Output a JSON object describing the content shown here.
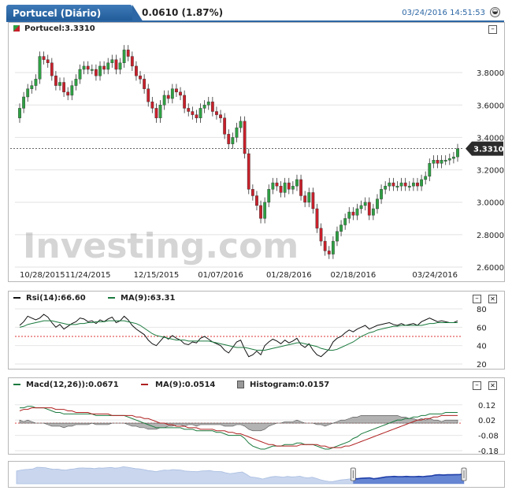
{
  "header": {
    "title": "Portucel (Diário)",
    "change": "0.0610 (1.87%)",
    "timestamp": "03/24/2016 14:51:53"
  },
  "watermark": "Investing.com",
  "main_panel": {
    "legend": "Portucel:3.3310",
    "last_price_label": "3.3310",
    "minimize": "–"
  },
  "rsi_panel": {
    "legend_rsi": "Rsi(14):66.60",
    "legend_ma": "MA(9):63.31",
    "minimize": "–",
    "close": "✕"
  },
  "macd_panel": {
    "legend_macd": "Macd(12,26)):0.0671",
    "legend_signal": "MA(9):0.0514",
    "legend_hist": "Histogram:0.0157",
    "minimize": "–",
    "close": "✕"
  },
  "colors": {
    "up": "#2ea043",
    "down": "#c8202b",
    "accent": "#2d67a5",
    "rsi_ma": "#1a7a3e",
    "macd_signal": "#b02020"
  },
  "chart_data": [
    {
      "type": "candlestick",
      "title": "Portucel:3.3310",
      "x_ticks": [
        "10/28/2015",
        "11/24/2015",
        "12/15/2015",
        "01/07/2016",
        "01/28/2016",
        "02/18/2016",
        "03/24/2016"
      ],
      "ylim": [
        2.6,
        4.0
      ],
      "y_ticks": [
        2.6,
        2.8,
        3.0,
        3.2,
        3.4,
        3.6,
        3.8
      ],
      "last_price": 3.331,
      "close": [
        3.58,
        3.65,
        3.7,
        3.72,
        3.76,
        3.9,
        3.88,
        3.86,
        3.78,
        3.72,
        3.74,
        3.68,
        3.66,
        3.72,
        3.76,
        3.82,
        3.84,
        3.82,
        3.82,
        3.78,
        3.84,
        3.82,
        3.86,
        3.88,
        3.82,
        3.86,
        3.94,
        3.9,
        3.84,
        3.78,
        3.76,
        3.7,
        3.62,
        3.58,
        3.52,
        3.6,
        3.66,
        3.64,
        3.7,
        3.68,
        3.66,
        3.58,
        3.56,
        3.54,
        3.52,
        3.58,
        3.6,
        3.62,
        3.56,
        3.54,
        3.52,
        3.42,
        3.36,
        3.4,
        3.46,
        3.5,
        3.3,
        3.08,
        3.04,
        2.98,
        2.9,
        3.0,
        3.08,
        3.12,
        3.1,
        3.06,
        3.12,
        3.08,
        3.1,
        3.14,
        3.04,
        3.0,
        3.06,
        2.96,
        2.84,
        2.76,
        2.7,
        2.68,
        2.76,
        2.82,
        2.86,
        2.9,
        2.94,
        2.92,
        2.96,
        2.98,
        3.0,
        2.92,
        2.96,
        3.02,
        3.08,
        3.1,
        3.12,
        3.1,
        3.1,
        3.12,
        3.1,
        3.1,
        3.12,
        3.1,
        3.14,
        3.16,
        3.24,
        3.26,
        3.24,
        3.26,
        3.26,
        3.27,
        3.28,
        3.33
      ],
      "open": [
        3.52,
        3.58,
        3.65,
        3.7,
        3.72,
        3.76,
        3.9,
        3.88,
        3.86,
        3.78,
        3.72,
        3.74,
        3.68,
        3.66,
        3.72,
        3.76,
        3.82,
        3.84,
        3.82,
        3.82,
        3.78,
        3.84,
        3.82,
        3.86,
        3.88,
        3.82,
        3.86,
        3.94,
        3.9,
        3.84,
        3.78,
        3.76,
        3.7,
        3.62,
        3.58,
        3.52,
        3.6,
        3.66,
        3.64,
        3.7,
        3.68,
        3.66,
        3.58,
        3.56,
        3.54,
        3.52,
        3.58,
        3.6,
        3.62,
        3.56,
        3.54,
        3.52,
        3.42,
        3.36,
        3.4,
        3.46,
        3.5,
        3.3,
        3.08,
        3.04,
        2.98,
        2.9,
        3.0,
        3.08,
        3.12,
        3.1,
        3.06,
        3.12,
        3.08,
        3.1,
        3.14,
        3.04,
        3.0,
        3.06,
        2.96,
        2.84,
        2.76,
        2.7,
        2.68,
        2.76,
        2.82,
        2.86,
        2.9,
        2.94,
        2.92,
        2.96,
        2.98,
        3.0,
        2.92,
        2.96,
        3.02,
        3.08,
        3.1,
        3.12,
        3.1,
        3.1,
        3.12,
        3.1,
        3.1,
        3.12,
        3.1,
        3.14,
        3.16,
        3.24,
        3.26,
        3.24,
        3.26,
        3.26,
        3.27,
        3.28
      ]
    },
    {
      "type": "line",
      "title": "Rsi(14):66.60",
      "ylim": [
        20,
        80
      ],
      "y_ticks": [
        20,
        40,
        60,
        80
      ],
      "series": [
        {
          "name": "Rsi(14)",
          "values": [
            62,
            66,
            72,
            70,
            68,
            70,
            74,
            71,
            65,
            60,
            63,
            58,
            61,
            64,
            66,
            70,
            69,
            66,
            67,
            64,
            68,
            66,
            69,
            71,
            65,
            67,
            72,
            68,
            62,
            58,
            55,
            52,
            46,
            42,
            40,
            45,
            50,
            47,
            51,
            48,
            46,
            42,
            41,
            44,
            43,
            48,
            50,
            47,
            44,
            42,
            40,
            35,
            32,
            38,
            44,
            46,
            36,
            28,
            30,
            34,
            30,
            40,
            44,
            47,
            45,
            42,
            46,
            43,
            45,
            48,
            41,
            38,
            42,
            35,
            30,
            28,
            32,
            36,
            44,
            48,
            50,
            54,
            57,
            55,
            58,
            60,
            62,
            58,
            60,
            62,
            63,
            64,
            65,
            63,
            62,
            64,
            62,
            63,
            64,
            62,
            66,
            68,
            70,
            68,
            66,
            67,
            66,
            65,
            65,
            67
          ]
        },
        {
          "name": "MA(9)",
          "values": [
            60,
            61,
            63,
            64,
            65,
            66,
            67,
            67,
            67,
            66,
            65,
            64,
            63,
            63,
            63,
            64,
            64,
            65,
            65,
            66,
            66,
            66,
            67,
            67,
            67,
            67,
            67,
            66,
            65,
            64,
            62,
            59,
            56,
            53,
            51,
            50,
            49,
            48,
            47,
            46,
            46,
            46,
            45,
            45,
            45,
            45,
            45,
            45,
            44,
            43,
            42,
            41,
            40,
            39,
            38,
            38,
            38,
            37,
            36,
            35,
            35,
            35,
            36,
            37,
            38,
            39,
            40,
            41,
            42,
            43,
            43,
            42,
            41,
            40,
            39,
            37,
            36,
            35,
            35,
            36,
            38,
            40,
            42,
            44,
            47,
            50,
            52,
            54,
            55,
            57,
            58,
            59,
            60,
            61,
            61,
            62,
            62,
            62,
            62,
            62,
            62,
            63,
            64,
            64,
            65,
            65,
            65,
            65,
            65,
            65
          ]
        }
      ]
    },
    {
      "type": "line",
      "title": "Macd(12,26)):0.0671",
      "ylim": [
        -0.18,
        0.16
      ],
      "y_ticks": [
        -0.18,
        -0.08,
        0.02,
        0.12
      ],
      "series": [
        {
          "name": "Macd(12,26))",
          "values": [
            0.1,
            0.1,
            0.11,
            0.11,
            0.1,
            0.1,
            0.1,
            0.09,
            0.08,
            0.07,
            0.07,
            0.06,
            0.06,
            0.06,
            0.06,
            0.06,
            0.06,
            0.06,
            0.06,
            0.05,
            0.05,
            0.05,
            0.05,
            0.05,
            0.05,
            0.05,
            0.05,
            0.04,
            0.03,
            0.02,
            0.01,
            0.0,
            -0.01,
            -0.02,
            -0.03,
            -0.03,
            -0.03,
            -0.03,
            -0.03,
            -0.03,
            -0.03,
            -0.04,
            -0.04,
            -0.04,
            -0.05,
            -0.05,
            -0.05,
            -0.05,
            -0.05,
            -0.06,
            -0.06,
            -0.07,
            -0.08,
            -0.08,
            -0.08,
            -0.08,
            -0.1,
            -0.13,
            -0.15,
            -0.16,
            -0.17,
            -0.17,
            -0.16,
            -0.15,
            -0.15,
            -0.15,
            -0.14,
            -0.14,
            -0.14,
            -0.13,
            -0.13,
            -0.14,
            -0.14,
            -0.14,
            -0.15,
            -0.16,
            -0.17,
            -0.17,
            -0.16,
            -0.15,
            -0.14,
            -0.13,
            -0.12,
            -0.1,
            -0.09,
            -0.07,
            -0.06,
            -0.05,
            -0.04,
            -0.03,
            -0.02,
            -0.01,
            0.0,
            0.01,
            0.02,
            0.02,
            0.03,
            0.03,
            0.04,
            0.04,
            0.05,
            0.05,
            0.06,
            0.06,
            0.06,
            0.06,
            0.07,
            0.07,
            0.07,
            0.07
          ]
        },
        {
          "name": "MA(9)",
          "values": [
            0.08,
            0.09,
            0.09,
            0.1,
            0.1,
            0.1,
            0.1,
            0.1,
            0.1,
            0.09,
            0.09,
            0.09,
            0.08,
            0.08,
            0.07,
            0.07,
            0.07,
            0.07,
            0.06,
            0.06,
            0.06,
            0.06,
            0.06,
            0.05,
            0.05,
            0.05,
            0.05,
            0.05,
            0.05,
            0.04,
            0.04,
            0.03,
            0.03,
            0.02,
            0.01,
            0.0,
            0.0,
            -0.01,
            -0.01,
            -0.02,
            -0.02,
            -0.02,
            -0.03,
            -0.03,
            -0.03,
            -0.04,
            -0.04,
            -0.04,
            -0.04,
            -0.05,
            -0.05,
            -0.05,
            -0.06,
            -0.06,
            -0.07,
            -0.07,
            -0.08,
            -0.09,
            -0.1,
            -0.11,
            -0.12,
            -0.13,
            -0.14,
            -0.14,
            -0.15,
            -0.15,
            -0.15,
            -0.15,
            -0.15,
            -0.15,
            -0.14,
            -0.14,
            -0.14,
            -0.14,
            -0.14,
            -0.15,
            -0.15,
            -0.16,
            -0.16,
            -0.16,
            -0.16,
            -0.15,
            -0.15,
            -0.14,
            -0.13,
            -0.12,
            -0.11,
            -0.1,
            -0.09,
            -0.08,
            -0.07,
            -0.06,
            -0.05,
            -0.04,
            -0.03,
            -0.02,
            -0.01,
            0.0,
            0.01,
            0.02,
            0.02,
            0.03,
            0.03,
            0.04,
            0.04,
            0.05,
            0.05,
            0.05,
            0.05,
            0.05
          ]
        }
      ]
    }
  ]
}
